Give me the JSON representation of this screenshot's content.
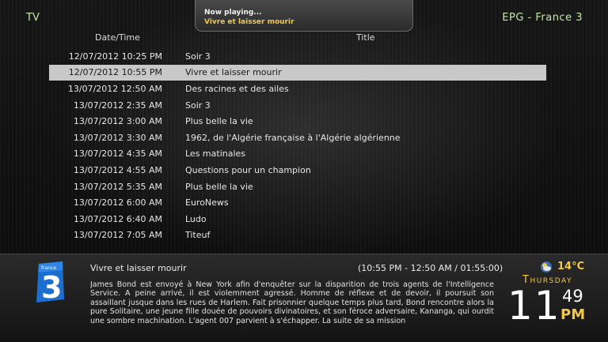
{
  "header": {
    "section": "TV",
    "epg_title": "EPG - France 3"
  },
  "now_playing": {
    "label": "Now playing...",
    "title": "Vivre et laisser mourir"
  },
  "columns": {
    "date": "Date/Time",
    "title": "Title"
  },
  "programs": [
    {
      "datetime": "12/07/2012 10:25 PM",
      "title": "Soir 3",
      "selected": false
    },
    {
      "datetime": "12/07/2012 10:55 PM",
      "title": "Vivre et laisser mourir",
      "selected": true
    },
    {
      "datetime": "13/07/2012 12:50 AM",
      "title": "Des racines et des ailes",
      "selected": false
    },
    {
      "datetime": "13/07/2012 2:35 AM",
      "title": "Soir 3",
      "selected": false
    },
    {
      "datetime": "13/07/2012 3:00 AM",
      "title": "Plus belle la vie",
      "selected": false
    },
    {
      "datetime": "13/07/2012 3:30 AM",
      "title": "1962, de l'Algérie française à l'Algérie algérienne",
      "selected": false
    },
    {
      "datetime": "13/07/2012 4:35 AM",
      "title": "Les matinales",
      "selected": false
    },
    {
      "datetime": "13/07/2012 4:55 AM",
      "title": "Questions pour un champion",
      "selected": false
    },
    {
      "datetime": "13/07/2012 5:35 AM",
      "title": "Plus belle la vie",
      "selected": false
    },
    {
      "datetime": "13/07/2012 6:00 AM",
      "title": "EuroNews",
      "selected": false
    },
    {
      "datetime": "13/07/2012 6:40 AM",
      "title": "Ludo",
      "selected": false
    },
    {
      "datetime": "13/07/2012 7:05 AM",
      "title": "Titeuf",
      "selected": false
    }
  ],
  "info": {
    "channel_logo_text": "france 3",
    "title": "Vivre et laisser mourir",
    "time_range": "(10:55 PM - 12:50 AM / 01:55:00)",
    "description": "James Bond est envoyé à New York afin d'enquêter sur la disparition de trois agents de l'Intelligence Service. A peine arrivé, il est violemment agressé. Homme de réflexe et de devoir, il poursuit son assaillant jusque dans les rues de Harlem. Fait prisonnier quelque temps plus tard, Bond rencontre alors la pure Solitaire, une jeune fille douée de pouvoirs divinatoires, et son féroce adversaire, Kananga, qui ourdit une sombre machination. L'agent 007 parvient à s'échapper. La suite de sa mission"
  },
  "weather": {
    "icon": "cloud-sun-icon",
    "temperature": "14°C"
  },
  "clock": {
    "day": "Thursday",
    "hour": "11",
    "minute": "49",
    "ampm": "PM"
  },
  "colors": {
    "accent": "#f2c84b",
    "header_text": "#c8e6a8",
    "selection": "#c8c8c8"
  }
}
